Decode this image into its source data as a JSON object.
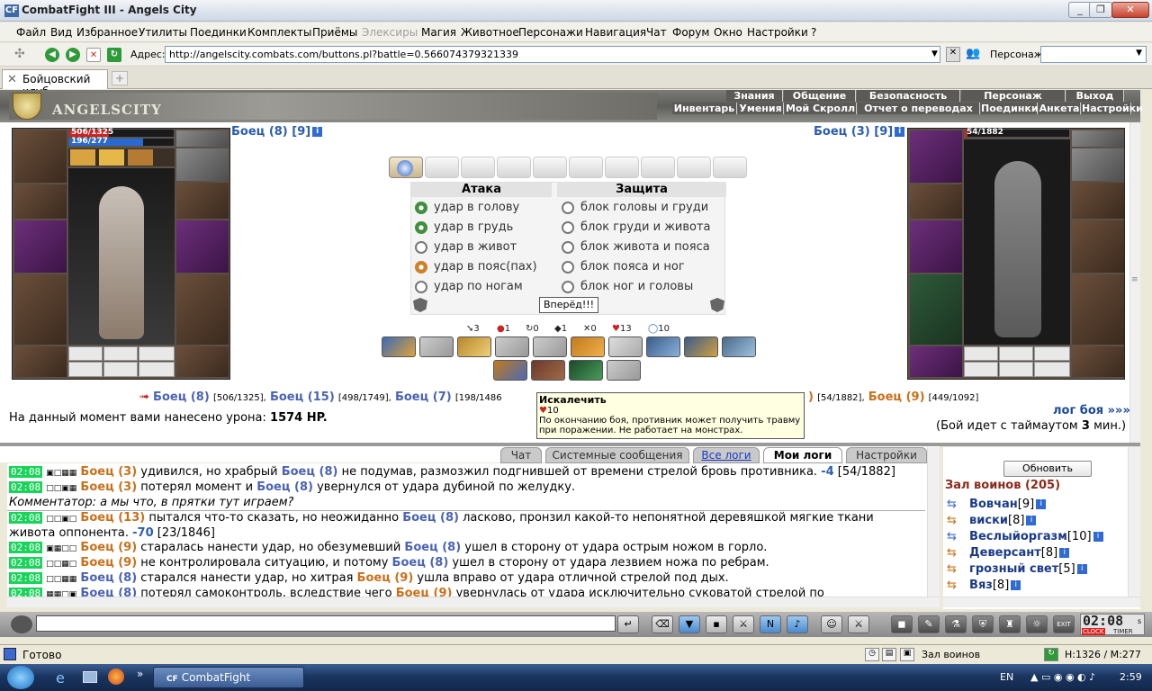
{
  "window": {
    "title": "CombatFight III - Angels City",
    "app_icon": "CF"
  },
  "menu": [
    "Файл",
    "Вид",
    "Избранное",
    "Утилиты",
    "Поединки",
    "Комплекты",
    "Приёмы",
    "Элексиры",
    "Магия",
    "Животное",
    "Персонажи",
    "Навигация",
    "Чат",
    "Форум",
    "Окно",
    "Настройки",
    "?"
  ],
  "address": {
    "label": "Адрес:",
    "url": "http://angelscity.combats.com/buttons.pl?battle=0.566074379321339",
    "persona_label": "Персонаж:"
  },
  "tab": {
    "label": "Бойцовский клуб"
  },
  "game": {
    "logo": "ANGELSCITY",
    "nav_top": [
      "Знания",
      "Общение",
      "Безопасность",
      "Персонаж",
      "Выход"
    ],
    "nav_bottom": [
      "Инвентарь",
      "Умения",
      "Мой Скролл",
      "Отчет о переводах",
      "Поединки",
      "Анкета",
      "Настройки"
    ]
  },
  "left_fighter": {
    "name": "Боец (8)",
    "level": "[9]",
    "hp": "506/1325",
    "mana": "196/277"
  },
  "right_fighter": {
    "name": "Боец (3)",
    "level": "[9]",
    "hp": "54/1882"
  },
  "attack": {
    "header": "Атака",
    "options": [
      "удар в голову",
      "удар в грудь",
      "удар в живот",
      "удар в пояс(пах)",
      "удар по ногам"
    ]
  },
  "defense": {
    "header": "Защита",
    "options": [
      "блок головы и груди",
      "блок груди и живота",
      "блок живота и пояса",
      "блок пояса и ног",
      "блок ног и головы"
    ]
  },
  "go_button": "Вперёд!!!",
  "stats": [
    "3",
    "1",
    "0",
    "1",
    "0",
    "13",
    "10"
  ],
  "tooltip": {
    "title": "Искалечить",
    "value": "10",
    "text": "По окончанию боя, противник может получить травму при поражении. Не работает на монстрах."
  },
  "fighters_line": [
    {
      "name": "Боец (8)",
      "hp": "[506/1325],"
    },
    {
      "name": "Боец (15)",
      "hp": "[498/1749],"
    },
    {
      "name": "Боец (7)",
      "hp": "[198/1486"
    },
    {
      "name": ")",
      "hp": "[54/1882],"
    },
    {
      "name": "Боец (9)",
      "hp": "[449/1092]"
    }
  ],
  "damage": {
    "label": "На данный момент вами нанесено урона:",
    "value": "1574 HP."
  },
  "log_link": "лог боя »»»",
  "timeout": {
    "text": "(Бой идет с таймаутом",
    "value": "3",
    "unit": "мин.)"
  },
  "chat_tabs": [
    "Чат",
    "Системные сообщения",
    "Все логи",
    "Мои логи",
    "Настройки"
  ],
  "log": [
    {
      "time": "02:08",
      "a": "Боец (3)",
      "t1": " удивился, но храбрый ",
      "b": "Боец (8)",
      "t2": " не подумав, размозжил подгнившей от времени стрелой бровь противника. ",
      "dmg": "-4",
      "rest": " [54/1882]"
    },
    {
      "time": "02:08",
      "a": "Боец (3)",
      "t1": " потерял момент и ",
      "b": "Боец (8)",
      "t2": " увернулся от удара дубиной по желудку.",
      "dmg": "",
      "rest": ""
    },
    {
      "comment": "Комментатор: а мы что, в прятки тут играем?"
    },
    {
      "time": "02:08",
      "a": "Боец (13)",
      "t1": " пытался что-то сказать, но неожиданно ",
      "b": "Боец (8)",
      "t2": " ласково, пронзил какой-то непонятной деревяшкой мягкие ткани",
      "dmg": "",
      "rest": ""
    },
    {
      "cont": "живота оппонента. ",
      "dmg": "-70",
      "rest": " [23/1846]"
    },
    {
      "time": "02:08",
      "a": "Боец (9)",
      "t1": " старалась нанести удар, но обезумевший ",
      "b": "Боец (8)",
      "t2": " ушел в сторону от удара острым ножом в горло.",
      "dmg": "",
      "rest": ""
    },
    {
      "time": "02:08",
      "a": "Боец (9)",
      "t1": " не контролировала ситуацию, и потому ",
      "b": "Боец (8)",
      "t2": " ушел в сторону от удара лезвием ножа по ребрам.",
      "dmg": "",
      "rest": ""
    },
    {
      "time": "02:08",
      "a": "Боец (8)",
      "t1": " старался нанести удар, но хитрая ",
      "b": "Боец (9)",
      "t2": " ушла вправо от удара отличной стрелой под дых.",
      "dmg": "",
      "rest": ""
    },
    {
      "time": "02:08",
      "a": "Боец (8)",
      "t1": " потерял самоконтроль, вследствие чего ",
      "b": "Боец (9)",
      "t2": " увернулась от удара исключительно суковатой стрелой по",
      "dmg": "",
      "rest": ""
    }
  ],
  "warriors": {
    "refresh": "Обновить",
    "title": "Зал воинов (205)",
    "list": [
      {
        "name": "Вовчан",
        "lvl": "[9]"
      },
      {
        "name": "виски",
        "lvl": "[8]"
      },
      {
        "name": "Веслыйоргазм",
        "lvl": "[10]"
      },
      {
        "name": "Деверсант",
        "lvl": "[8]"
      },
      {
        "name": "грозный свет",
        "lvl": "[5]"
      },
      {
        "name": "Вяз",
        "lvl": "[8]"
      }
    ]
  },
  "clock": {
    "time": "02:08",
    "suffix": "s",
    "clock_label": "CLOCK",
    "timer_label": "TIMER"
  },
  "status": {
    "text": "Готово",
    "location": "Зал воинов",
    "hm": "H:1326 / M:277"
  },
  "taskbar": {
    "task": "CombatFight",
    "lang": "EN",
    "time": "2:59"
  }
}
